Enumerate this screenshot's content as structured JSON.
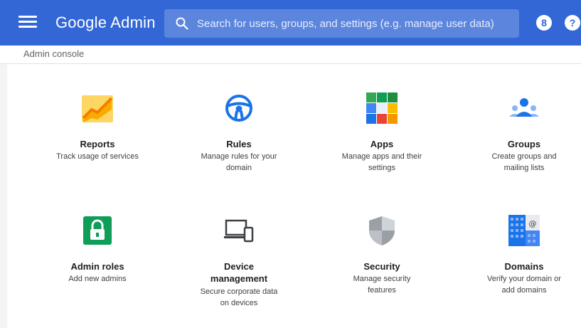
{
  "header": {
    "logo_google": "Google",
    "logo_admin": "Admin",
    "search_placeholder": "Search for users, groups, and settings (e.g. manage user data)",
    "account_icon_glyph": "8",
    "help_icon_glyph": "?"
  },
  "breadcrumb": "Admin console",
  "colors": {
    "header_bg": "#3367d6",
    "search_bg": "#5c85de"
  },
  "cards": [
    {
      "id": "reports",
      "title_lines": [
        "Reports"
      ],
      "desc_lines": [
        "Track usage of services"
      ],
      "icon": "reports-chart-icon"
    },
    {
      "id": "rules",
      "title_lines": [
        "Rules"
      ],
      "desc_lines": [
        "Manage rules for your",
        "domain"
      ],
      "icon": "steering-wheel-icon"
    },
    {
      "id": "apps",
      "title_lines": [
        "Apps"
      ],
      "desc_lines": [
        "Manage apps and their",
        "settings"
      ],
      "icon": "apps-grid-icon"
    },
    {
      "id": "groups",
      "title_lines": [
        "Groups"
      ],
      "desc_lines": [
        "Create groups and",
        "mailing lists"
      ],
      "icon": "groups-people-icon"
    },
    {
      "id": "admin-roles",
      "title_lines": [
        "Admin roles"
      ],
      "desc_lines": [
        "Add new admins"
      ],
      "icon": "padlock-icon"
    },
    {
      "id": "device-management",
      "title_lines": [
        "Device",
        "management"
      ],
      "desc_lines": [
        "Secure corporate data",
        "on devices"
      ],
      "icon": "laptop-phone-icon"
    },
    {
      "id": "security",
      "title_lines": [
        "Security"
      ],
      "desc_lines": [
        "Manage security",
        "features"
      ],
      "icon": "shield-icon"
    },
    {
      "id": "domains",
      "title_lines": [
        "Domains"
      ],
      "desc_lines": [
        "Verify your domain or",
        "add domains"
      ],
      "icon": "building-at-icon"
    }
  ]
}
